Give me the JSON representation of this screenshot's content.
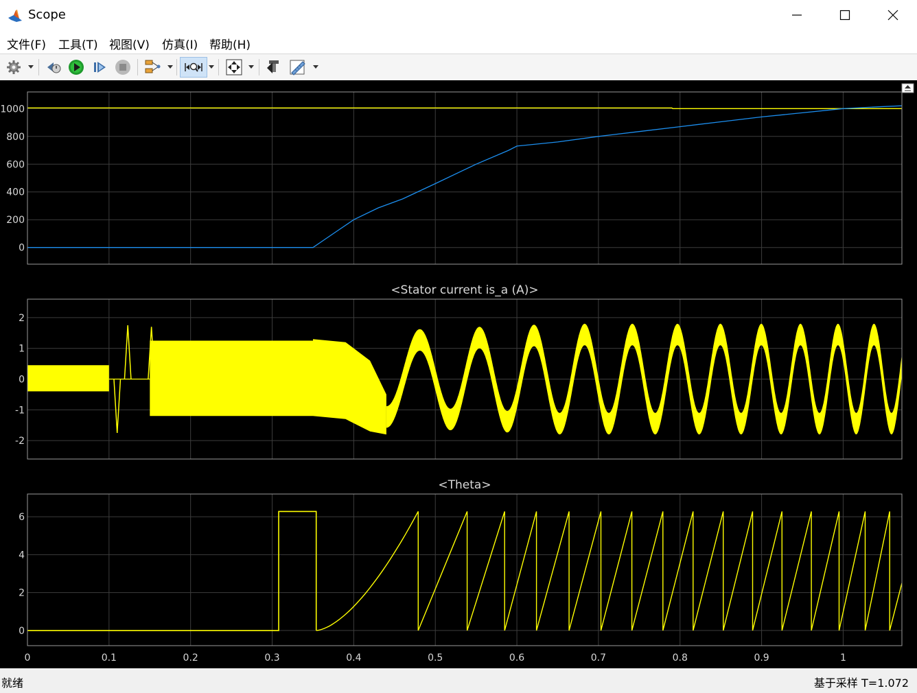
{
  "window": {
    "title": "Scope"
  },
  "menu": [
    "文件(F)",
    "工具(T)",
    "视图(V)",
    "仿真(I)",
    "帮助(H)"
  ],
  "toolbar": {
    "icons": [
      "gear-icon",
      "step-back-icon",
      "run-icon",
      "step-forward-icon",
      "stop-icon",
      "signal-select-icon",
      "zoom-icon",
      "autoscale-icon",
      "highlight-block-icon",
      "measure-icon"
    ]
  },
  "status": {
    "left": "就绪",
    "right": "基于采样 T=1.072"
  },
  "colors": {
    "background": "#000000",
    "axes_bg": "#000000",
    "grid": "#3d3d3d",
    "axes_border": "#9a9a9a",
    "text": "#d8d8d8",
    "yellow": "#ffff00",
    "blue": "#1c8ff0"
  },
  "chart_data": [
    {
      "type": "line",
      "title": "",
      "xlim": [
        0,
        1.072
      ],
      "ylim": [
        -120,
        1120
      ],
      "yticks": [
        0,
        200,
        400,
        600,
        800,
        1000
      ],
      "xticks": [
        0,
        0.1,
        0.2,
        0.3,
        0.4,
        0.5,
        0.6,
        0.7,
        0.8,
        0.9,
        1.0
      ],
      "grid": true,
      "series": [
        {
          "color": "#ffff00",
          "x": [
            0,
            0.79,
            0.791,
            1.072
          ],
          "y": [
            1005,
            1005,
            1000,
            1000
          ]
        },
        {
          "color": "#1c8ff0",
          "x": [
            0,
            0.35,
            0.36,
            0.38,
            0.4,
            0.43,
            0.46,
            0.5,
            0.55,
            0.59,
            0.6,
            0.65,
            0.7,
            0.75,
            0.8,
            0.85,
            0.9,
            0.95,
            1.0,
            1.05,
            1.072
          ],
          "y": [
            0,
            0,
            40,
            120,
            200,
            285,
            350,
            460,
            600,
            700,
            730,
            760,
            800,
            835,
            870,
            905,
            940,
            970,
            1000,
            1015,
            1020
          ]
        }
      ]
    },
    {
      "type": "line",
      "title": "<Stator current is_a (A)>",
      "xlim": [
        0,
        1.072
      ],
      "ylim": [
        -2.6,
        2.6
      ],
      "yticks": [
        -2,
        -1,
        0,
        1,
        2
      ],
      "xticks": [
        0,
        0.1,
        0.2,
        0.3,
        0.4,
        0.5,
        0.6,
        0.7,
        0.8,
        0.9,
        1.0
      ],
      "grid": true,
      "series": [
        {
          "color": "#ffff00",
          "bands": [
            {
              "x": [
                0,
                0.1
              ],
              "upper": [
                0.45,
                0.45
              ],
              "lower": [
                -0.4,
                -0.4
              ]
            },
            {
              "x": [
                0.15,
                0.35
              ],
              "upper": [
                1.25,
                1.25
              ],
              "lower": [
                -1.2,
                -1.2
              ]
            },
            {
              "x": [
                0.35,
                0.39,
                0.42,
                0.44
              ],
              "upper": [
                1.3,
                1.2,
                0.6,
                -0.5
              ],
              "lower": [
                -1.2,
                -1.3,
                -1.7,
                -1.8
              ]
            }
          ],
          "oscillation": {
            "x_start": 0.44,
            "x_end": 1.072,
            "amplitude": 1.45,
            "envelope_width": 0.35,
            "period_start": 0.09,
            "period_end": 0.042
          },
          "spikes": [
            {
              "x": 0.11,
              "y": -1.75
            },
            {
              "x": 0.123,
              "y": 1.75
            },
            {
              "x": 0.152,
              "y": 1.7
            }
          ]
        }
      ]
    },
    {
      "type": "line",
      "title": "<Theta>",
      "xlim": [
        0,
        1.072
      ],
      "ylim": [
        -0.8,
        7.2
      ],
      "yticks": [
        0,
        2,
        4,
        6
      ],
      "xticks": [
        0,
        0.1,
        0.2,
        0.3,
        0.4,
        0.5,
        0.6,
        0.7,
        0.8,
        0.9,
        1.0
      ],
      "xticklabels": [
        "0",
        "0.1",
        "0.2",
        "0.3",
        "0.4",
        "0.5",
        "0.6",
        "0.7",
        "0.8",
        "0.9",
        "1"
      ],
      "grid": true,
      "series": [
        {
          "color": "#ffff00",
          "pulse": {
            "x0": 0.308,
            "x1": 0.354,
            "y": 6.28
          },
          "ramp_first": {
            "x0": 0.354,
            "x1": 0.479,
            "y1": 6.28
          },
          "resets": [
            0.479,
            0.539,
            0.585,
            0.624,
            0.664,
            0.703,
            0.741,
            0.779,
            0.816,
            0.853,
            0.889,
            0.925,
            0.961,
            0.995,
            1.027,
            1.057
          ],
          "last_y": 2.5
        }
      ]
    }
  ]
}
